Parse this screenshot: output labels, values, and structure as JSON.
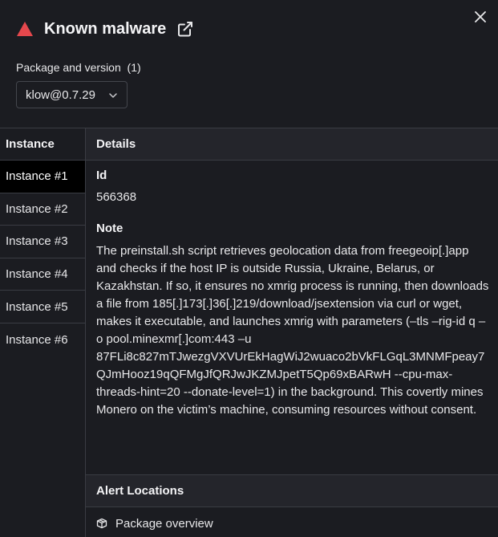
{
  "header": {
    "title": "Known malware",
    "icons": {
      "warning": "warning-triangle-icon",
      "external": "external-link-icon",
      "close": "close-icon"
    },
    "warning_color": "#e5484d"
  },
  "package": {
    "label": "Package and version  (1)",
    "selected": "klow@0.7.29"
  },
  "instances": {
    "header": "Instance",
    "items": [
      "Instance #1",
      "Instance #2",
      "Instance #3",
      "Instance #4",
      "Instance #5",
      "Instance #6"
    ],
    "active_index": 0
  },
  "details": {
    "header": "Details",
    "id_label": "Id",
    "id_value": "566368",
    "note_label": "Note",
    "note_value": "The preinstall.sh script retrieves geolocation data from freegeoip[.]app and checks if the host IP is outside Russia, Ukraine, Belarus, or Kazakhstan. If so, it ensures no xmrig process is running, then downloads a file from 185[.]173[.]36[.]219/download/jsextension via curl or wget, makes it executable, and launches xmrig with parameters (–tls –rig-id q –o pool.minexmr[.]com:443 –u 87FLi8c827mTJwezgVXVUrEkHagWiJ2wuaco2bVkFLGqL3MNMFpeay7QJmHooz19qQFMgJfQRJwJKZMJpetT5Qp69xBARwH --cpu-max-threads-hint=20 --donate-level=1) in the background. This covertly mines Monero on the victim’s machine, consuming resources without consent."
  },
  "alert_locations": {
    "header": "Alert Locations",
    "items": [
      {
        "label": "Package overview",
        "icon": "package-box-icon"
      }
    ]
  }
}
